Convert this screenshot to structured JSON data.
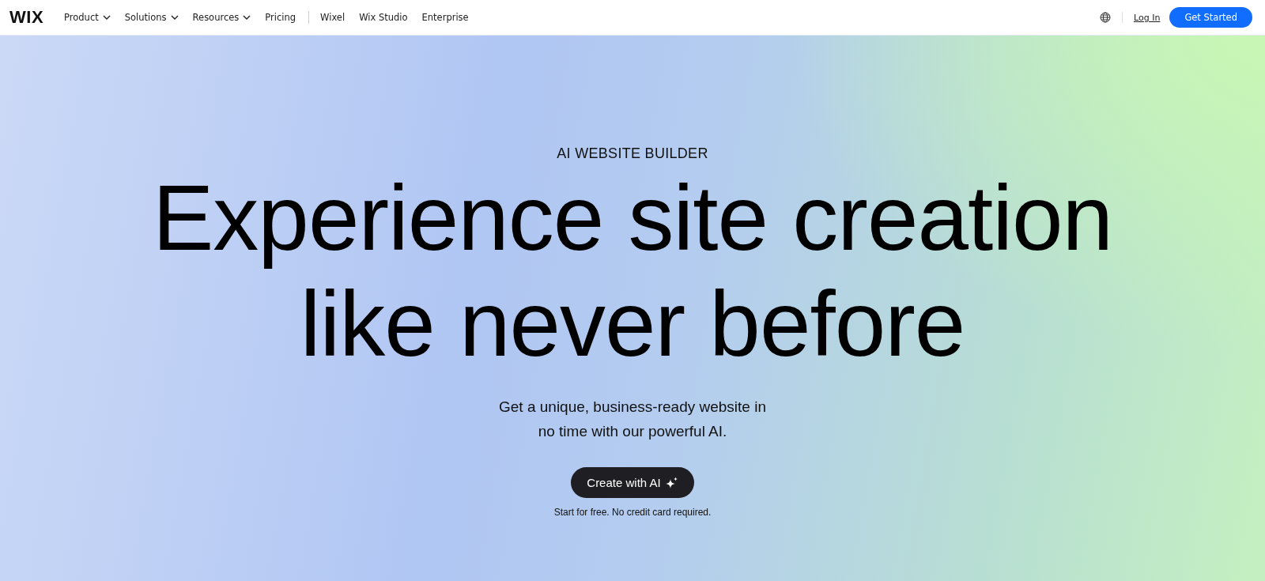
{
  "header": {
    "logo": "WIX",
    "primary_nav": [
      {
        "label": "Product",
        "has_menu": true
      },
      {
        "label": "Solutions",
        "has_menu": true
      },
      {
        "label": "Resources",
        "has_menu": true
      },
      {
        "label": "Pricing",
        "has_menu": false
      }
    ],
    "secondary_nav": [
      {
        "label": "Wixel"
      },
      {
        "label": "Wix Studio"
      },
      {
        "label": "Enterprise"
      }
    ],
    "login": "Log In",
    "cta": "Get Started"
  },
  "hero": {
    "eyebrow": "AI WEBSITE BUILDER",
    "headline": [
      "Experience site creation",
      "like never before"
    ],
    "subtitle": [
      "Get a unique, business-ready website in",
      "no time with our powerful AI."
    ],
    "button": "Create with AI",
    "note": "Start for free. No credit card required."
  }
}
